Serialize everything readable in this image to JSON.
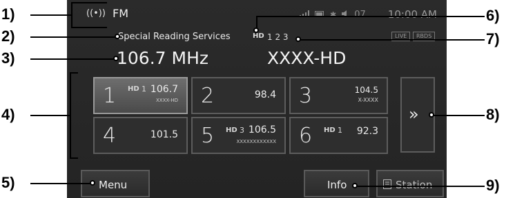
{
  "callouts": [
    "1)",
    "2)",
    "3)",
    "4)",
    "5)",
    "6)",
    "7)",
    "8)",
    "9)"
  ],
  "header": {
    "radio_icon": "((•))",
    "band": "FM",
    "clock": "10:00 AM",
    "status_icons": [
      "signal-icon",
      "battery-icon",
      "bluetooth-icon",
      "volume-icon"
    ],
    "volume_level": "07"
  },
  "station": {
    "service_text": "Special Reading Services",
    "hd_logo": "HD",
    "hd_channels": "1 2 3",
    "frequency": "106.7 MHz",
    "call_sign": "XXXX-HD",
    "badges": [
      "LIVE",
      "RBDS"
    ]
  },
  "presets": [
    {
      "num": "1",
      "freq": "106.7",
      "name": "XXXX-HD",
      "hd": "HD",
      "hd_sub": "1"
    },
    {
      "num": "2",
      "freq": "98.4",
      "name": "",
      "hd": "",
      "hd_sub": ""
    },
    {
      "num": "3",
      "freq": "104.5",
      "name": "X-XXXX",
      "hd": "",
      "hd_sub": ""
    },
    {
      "num": "4",
      "freq": "101.5",
      "name": "",
      "hd": "",
      "hd_sub": ""
    },
    {
      "num": "5",
      "freq": "106.5",
      "name": "XXXXXXXXXXXX",
      "hd": "HD",
      "hd_sub": "3"
    },
    {
      "num": "6",
      "freq": "92.3",
      "name": "",
      "hd": "HD",
      "hd_sub": "1"
    }
  ],
  "next_button": "»",
  "buttons": {
    "menu": "Menu",
    "info": "Info",
    "station": "Station"
  }
}
